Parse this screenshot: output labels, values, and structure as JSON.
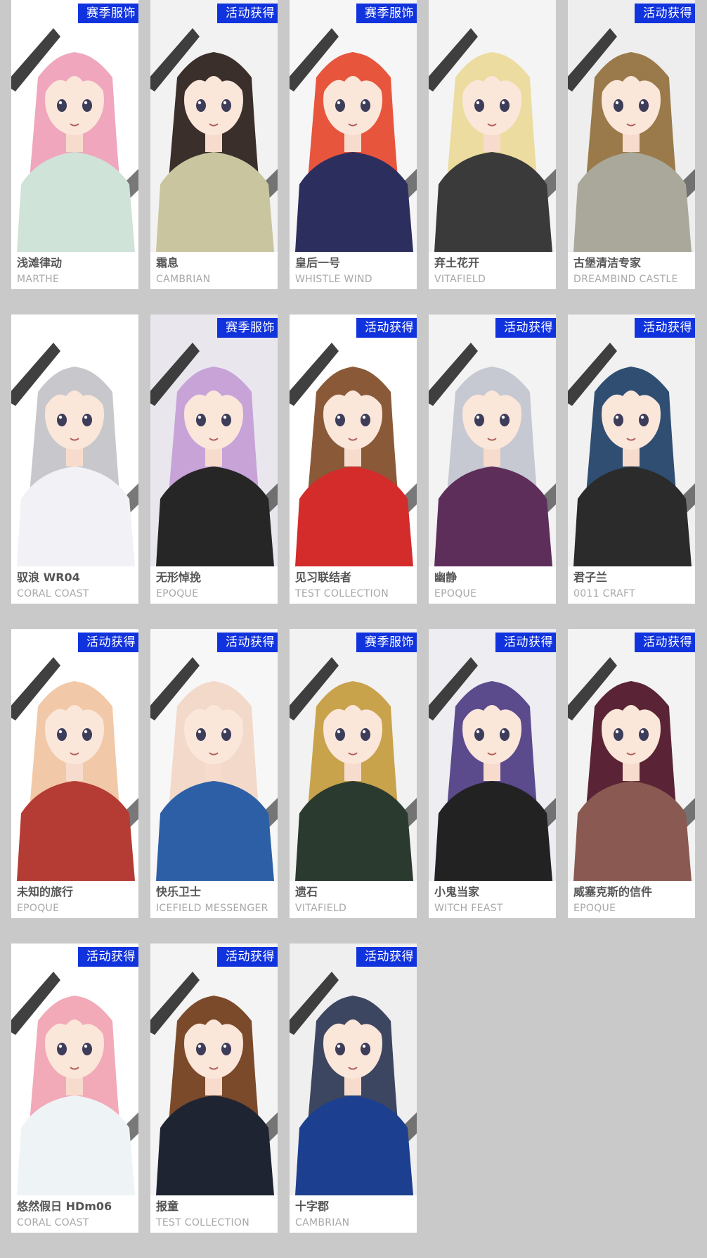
{
  "cards": [
    {
      "name": "浅滩律动",
      "series": "MARTHE",
      "badge": "赛季服饰",
      "hair": "#f0a6bd",
      "outfit": "#cfe3d8",
      "bg": "#ffffff"
    },
    {
      "name": "霜息",
      "series": "CAMBRIAN",
      "badge": "活动获得",
      "hair": "#3a2f2a",
      "outfit": "#c9c59e",
      "bg": "#f2f2f2"
    },
    {
      "name": "皇后一号",
      "series": "WHISTLE WIND",
      "badge": "赛季服饰",
      "hair": "#e8553d",
      "outfit": "#2c2f5e",
      "bg": "#f6f6f6"
    },
    {
      "name": "弃土花开",
      "series": "VITAFIELD",
      "badge": "",
      "hair": "#ecdca0",
      "outfit": "#3a3a3a",
      "bg": "#f4f4f4"
    },
    {
      "name": "古堡清洁专家",
      "series": "DREAMBIND CASTLE",
      "badge": "活动获得",
      "hair": "#9a7a4a",
      "outfit": "#a9a89a",
      "bg": "#eeeeee"
    },
    {
      "name": "驭浪 WR04",
      "series": "CORAL COAST",
      "badge": "",
      "hair": "#c8c8cc",
      "outfit": "#f1f1f6",
      "bg": "#ffffff"
    },
    {
      "name": "无形悼挽",
      "series": "EPOQUE",
      "badge": "赛季服饰",
      "hair": "#c7a3d8",
      "outfit": "#262626",
      "bg": "#e9e6ee"
    },
    {
      "name": "见习联结者",
      "series": "TEST COLLECTION",
      "badge": "活动获得",
      "hair": "#8a5a38",
      "outfit": "#d42b2b",
      "bg": "#ffffff"
    },
    {
      "name": "幽静",
      "series": "EPOQUE",
      "badge": "活动获得",
      "hair": "#c6c8d2",
      "outfit": "#5e2e5a",
      "bg": "#f3f3f3"
    },
    {
      "name": "君子兰",
      "series": "0011 CRAFT",
      "badge": "活动获得",
      "hair": "#2f4e72",
      "outfit": "#2b2b2b",
      "bg": "#f1f1f1"
    },
    {
      "name": "未知的旅行",
      "series": "EPOQUE",
      "badge": "活动获得",
      "hair": "#f1c9a8",
      "outfit": "#b43c34",
      "bg": "#ffffff"
    },
    {
      "name": "快乐卫士",
      "series": "ICEFIELD MESSENGER",
      "badge": "活动获得",
      "hair": "#f3d9c9",
      "outfit": "#2d5fa6",
      "bg": "#f7f7f7"
    },
    {
      "name": "遗石",
      "series": "VITAFIELD",
      "badge": "赛季服饰",
      "hair": "#c9a24c",
      "outfit": "#2b3a2e",
      "bg": "#f2f2f2"
    },
    {
      "name": "小鬼当家",
      "series": "WITCH FEAST",
      "badge": "活动获得",
      "hair": "#5b4a8c",
      "outfit": "#222222",
      "bg": "#ededf2"
    },
    {
      "name": "威塞克斯的信件",
      "series": "EPOQUE",
      "badge": "活动获得",
      "hair": "#5a2436",
      "outfit": "#8a5a52",
      "bg": "#f3f3f3"
    },
    {
      "name": "悠然假日 HDm06",
      "series": "CORAL COAST",
      "badge": "活动获得",
      "hair": "#f2a9b8",
      "outfit": "#eef3f6",
      "bg": "#ffffff"
    },
    {
      "name": "报童",
      "series": "TEST COLLECTION",
      "badge": "活动获得",
      "hair": "#7a4a2a",
      "outfit": "#1f2433",
      "bg": "#f4f4f4"
    },
    {
      "name": "十字郡",
      "series": "CAMBRIAN",
      "badge": "活动获得",
      "hair": "#3c4660",
      "outfit": "#1d3f8f",
      "bg": "#efefef"
    }
  ]
}
